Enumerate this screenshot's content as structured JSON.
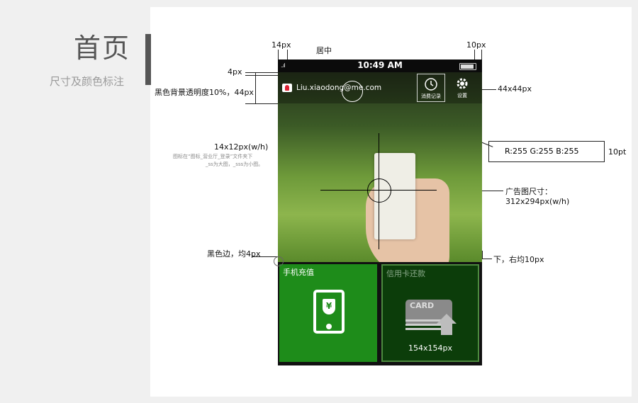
{
  "page": {
    "title": "首页",
    "subtitle": "尺寸及颜色标注"
  },
  "annotations": {
    "left_edge": "14px",
    "center": "居中",
    "right_edge": "10px",
    "top_gap": "4px",
    "bar_spec": "黑色背景透明度10%，44px",
    "avatar_size": "14x12px(w/h)",
    "avatar_note": "图标在“图标_营业厅_登录”文件夹下",
    "avatar_note2": "_ss为大图，_sss为小图。",
    "button_size": "44x44px",
    "rgb": "R:255  G:255  B:255",
    "font_size": "10pt",
    "ad_size_label": "广告图尺寸：",
    "ad_size_value": "312x294px(w/h)",
    "border": "黑色边，均4px",
    "pager": "下，右均10px"
  },
  "phone": {
    "time": "10:49 AM",
    "signal": "..ıl",
    "email": "Liu.xiaodong@me.com",
    "records_label": "消费记录",
    "settings_label": "设置",
    "tiles": [
      {
        "label": "手机充值",
        "icon_symbol": "¥"
      },
      {
        "label": "信用卡还款",
        "card_text": "CARD",
        "size_note": "154x154px"
      }
    ]
  },
  "colors": {
    "tile_green": "#1e8c1a",
    "tile_dark": "#0c3d0a",
    "pager_active": "#4ad13a"
  }
}
